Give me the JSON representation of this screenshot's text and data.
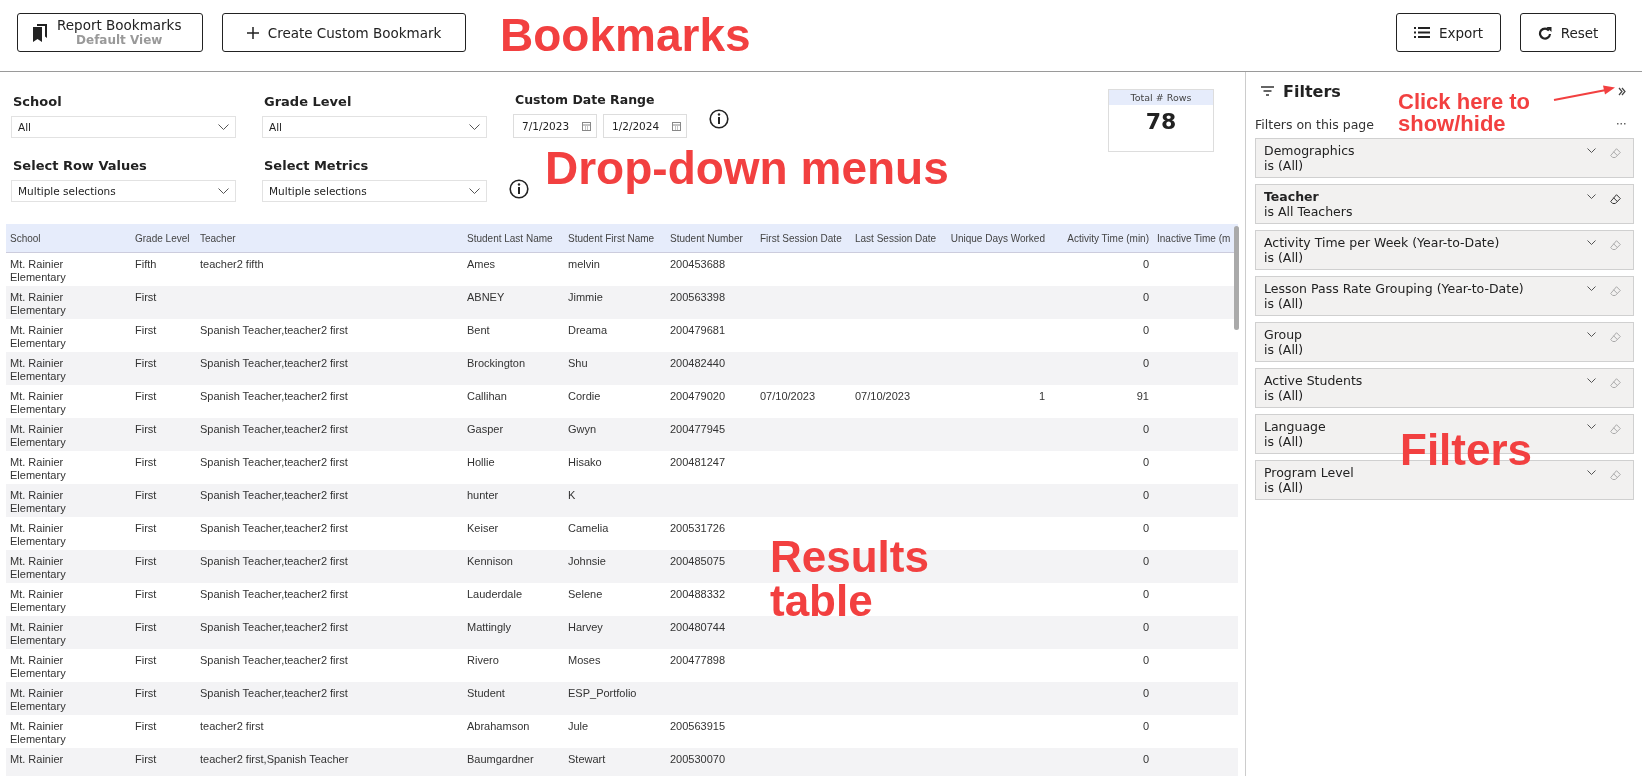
{
  "toolbar": {
    "bookmarks_button": {
      "label": "Report Bookmarks",
      "sublabel": "Default View"
    },
    "create_button": "Create Custom Bookmark",
    "export_button": "Export",
    "reset_button": "Reset"
  },
  "slicer_rows": [
    [
      {
        "kind": "dropdown",
        "label": "School",
        "value": "All",
        "info": false
      },
      {
        "kind": "dropdown",
        "label": "Grade Level",
        "value": "All",
        "info": false
      },
      {
        "kind": "daterange",
        "label": "Custom Date Range",
        "start": "7/1/2023",
        "end": "1/2/2024",
        "info": true
      }
    ],
    [
      {
        "kind": "dropdown",
        "label": "Select Row Values",
        "value": "Multiple selections",
        "info": false
      },
      {
        "kind": "dropdown",
        "label": "Select Metrics",
        "value": "Multiple selections",
        "info": true
      }
    ]
  ],
  "total_card": {
    "label": "Total # Rows",
    "value": "78"
  },
  "table": {
    "columns": [
      "School",
      "Grade Level",
      "Teacher",
      "Student Last Name",
      "Student First Name",
      "Student Number",
      "First Session Date",
      "Last Session Date",
      "Unique Days Worked",
      "Activity Time (min)",
      "Inactive Time (m"
    ],
    "rows": [
      [
        "Mt. Rainier Elementary",
        "Fifth",
        "teacher2 fifth",
        "Ames",
        "melvin",
        "200453688",
        "",
        "",
        "",
        "0",
        ""
      ],
      [
        "Mt. Rainier Elementary",
        "First",
        "",
        "ABNEY",
        "Jimmie",
        "200563398",
        "",
        "",
        "",
        "0",
        ""
      ],
      [
        "Mt. Rainier Elementary",
        "First",
        "Spanish Teacher,teacher2 first",
        "Bent",
        "Dreama",
        "200479681",
        "",
        "",
        "",
        "0",
        ""
      ],
      [
        "Mt. Rainier Elementary",
        "First",
        "Spanish Teacher,teacher2 first",
        "Brockington",
        "Shu",
        "200482440",
        "",
        "",
        "",
        "0",
        ""
      ],
      [
        "Mt. Rainier Elementary",
        "First",
        "Spanish Teacher,teacher2 first",
        "Callihan",
        "Cordie",
        "200479020",
        "07/10/2023",
        "07/10/2023",
        "1",
        "91",
        ""
      ],
      [
        "Mt. Rainier Elementary",
        "First",
        "Spanish Teacher,teacher2 first",
        "Gasper",
        "Gwyn",
        "200477945",
        "",
        "",
        "",
        "0",
        ""
      ],
      [
        "Mt. Rainier Elementary",
        "First",
        "Spanish Teacher,teacher2 first",
        "Hollie",
        "Hisako",
        "200481247",
        "",
        "",
        "",
        "0",
        ""
      ],
      [
        "Mt. Rainier Elementary",
        "First",
        "Spanish Teacher,teacher2 first",
        "hunter",
        "K",
        "",
        "",
        "",
        "",
        "0",
        ""
      ],
      [
        "Mt. Rainier Elementary",
        "First",
        "Spanish Teacher,teacher2 first",
        "Keiser",
        "Camelia",
        "200531726",
        "",
        "",
        "",
        "0",
        ""
      ],
      [
        "Mt. Rainier Elementary",
        "First",
        "Spanish Teacher,teacher2 first",
        "Kennison",
        "Johnsie",
        "200485075",
        "",
        "",
        "",
        "0",
        ""
      ],
      [
        "Mt. Rainier Elementary",
        "First",
        "Spanish Teacher,teacher2 first",
        "Lauderdale",
        "Selene",
        "200488332",
        "",
        "",
        "",
        "0",
        ""
      ],
      [
        "Mt. Rainier Elementary",
        "First",
        "Spanish Teacher,teacher2 first",
        "Mattingly",
        "Harvey",
        "200480744",
        "",
        "",
        "",
        "0",
        ""
      ],
      [
        "Mt. Rainier Elementary",
        "First",
        "Spanish Teacher,teacher2 first",
        "Rivero",
        "Moses",
        "200477898",
        "",
        "",
        "",
        "0",
        ""
      ],
      [
        "Mt. Rainier Elementary",
        "First",
        "Spanish Teacher,teacher2 first",
        "Student",
        "ESP_Portfolio",
        "",
        "",
        "",
        "",
        "0",
        ""
      ],
      [
        "Mt. Rainier Elementary",
        "First",
        "teacher2 first",
        "Abrahamson",
        "Jule",
        "200563915",
        "",
        "",
        "",
        "0",
        ""
      ],
      [
        "Mt. Rainier",
        "First",
        "teacher2 first,Spanish Teacher",
        "Baumgardner",
        "Stewart",
        "200530070",
        "",
        "",
        "",
        "0",
        ""
      ]
    ]
  },
  "filters_pane": {
    "title": "Filters",
    "subtitle": "Filters on this page",
    "filters": [
      {
        "name": "Demographics",
        "condition": "is (All)",
        "applied": false
      },
      {
        "name": "Teacher",
        "condition": "is All Teachers",
        "applied": true
      },
      {
        "name": "Activity Time per Week (Year-to-Date)",
        "condition": "is (All)",
        "applied": false
      },
      {
        "name": "Lesson Pass Rate Grouping (Year-to-Date)",
        "condition": "is (All)",
        "applied": false
      },
      {
        "name": "Group",
        "condition": "is (All)",
        "applied": false
      },
      {
        "name": "Active Students",
        "condition": "is (All)",
        "applied": false
      },
      {
        "name": "Language",
        "condition": "is (All)",
        "applied": false
      },
      {
        "name": "Program Level",
        "condition": "is (All)",
        "applied": false
      }
    ]
  },
  "annotations": [
    {
      "text": "Bookmarks"
    },
    {
      "text": "Drop-down menus"
    },
    {
      "text": "Click here to show/hide"
    },
    {
      "text": "Results table"
    },
    {
      "text": "Filters"
    }
  ]
}
